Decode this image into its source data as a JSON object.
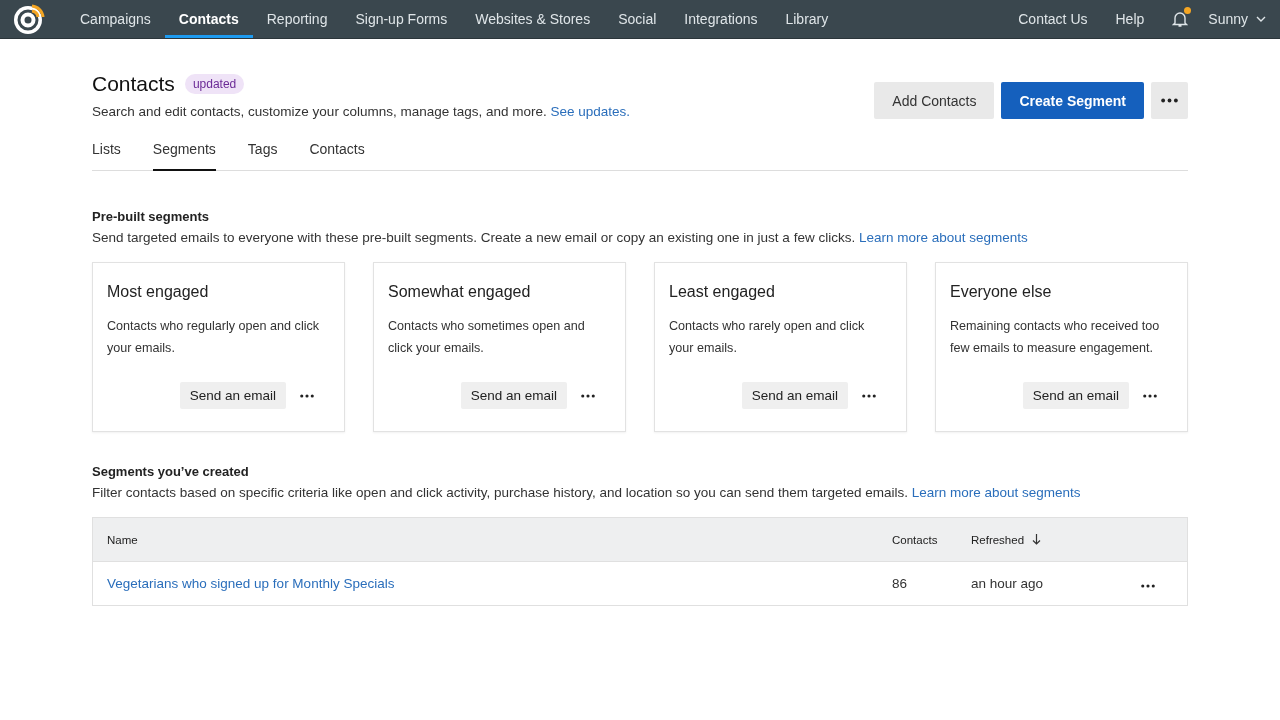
{
  "nav": {
    "items": [
      {
        "label": "Campaigns",
        "selected": false
      },
      {
        "label": "Contacts",
        "selected": true
      },
      {
        "label": "Reporting",
        "selected": false
      },
      {
        "label": "Sign-up Forms",
        "selected": false
      },
      {
        "label": "Websites & Stores",
        "selected": false
      },
      {
        "label": "Social",
        "selected": false
      },
      {
        "label": "Integrations",
        "selected": false
      },
      {
        "label": "Library",
        "selected": false
      }
    ],
    "right": [
      "Contact Us",
      "Help"
    ],
    "notifications_unread": true,
    "user": "Sunny"
  },
  "header": {
    "title": "Contacts",
    "badge": "updated",
    "description": "Search and edit contacts, customize your columns, manage tags, and more.",
    "link": "See updates.",
    "buttons": [
      {
        "label": "Add Contacts",
        "kind": "secondary"
      },
      {
        "label": "Create Segment",
        "kind": "primary"
      }
    ]
  },
  "tabs": [
    {
      "label": "Lists",
      "selected": false
    },
    {
      "label": "Segments",
      "selected": true
    },
    {
      "label": "Tags",
      "selected": false
    },
    {
      "label": "Contacts",
      "selected": false
    }
  ],
  "prebuilt": {
    "title": "Pre-built segments",
    "description": "Send targeted emails to everyone with these pre-built segments. Create a new email or copy an existing one in just a few clicks.",
    "link": "Learn more about segments",
    "cards": [
      {
        "title": "Most engaged",
        "text": "Contacts who regularly open and click your emails.",
        "action": "Send an email"
      },
      {
        "title": "Somewhat engaged",
        "text": "Contacts who sometimes open and click your emails.",
        "action": "Send an email"
      },
      {
        "title": "Least engaged",
        "text": "Contacts who rarely open and click your emails.",
        "action": "Send an email"
      },
      {
        "title": "Everyone else",
        "text": "Remaining contacts who received too few emails to measure engagement.",
        "action": "Send an email"
      }
    ]
  },
  "created": {
    "title": "Segments you’ve created",
    "description": "Filter contacts based on specific criteria like open and click activity, purchase history, and location so you can send them targeted emails.",
    "link": "Learn more about segments",
    "table": {
      "columns": [
        "Name",
        "Contacts",
        "Refreshed"
      ],
      "rows": [
        {
          "name": "Vegetarians who signed up for Monthly Specials",
          "contacts": "86",
          "refreshed": "an hour ago"
        }
      ]
    }
  }
}
